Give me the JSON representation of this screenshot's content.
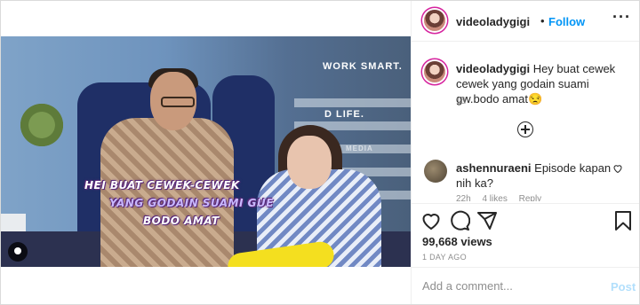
{
  "post": {
    "username": "videoladygigi",
    "separator": "•",
    "follow_label": "Follow",
    "more_label": "···",
    "caption_text": " Hey buat cewek cewek yang godain suami gw.bodo amat😒",
    "caption_time": "1d",
    "video_overlay": {
      "sign_top": "WORK SMART.",
      "sign_mid": "D LIFE.",
      "sign_small": "MEDIA",
      "subtitle_line1": "HEI BUAT CEWEK-CEWEK",
      "subtitle_line2": "YANG GODAIN SUAMI GUE",
      "subtitle_line3": "BODO AMAT"
    }
  },
  "comments": [
    {
      "username": "ashennuraeni",
      "text": " Episode kapan nih ka?",
      "time": "22h",
      "likes": "4 likes",
      "reply": "Reply"
    }
  ],
  "actions": {
    "icons": [
      "heart-icon",
      "comment-icon",
      "share-icon",
      "bookmark-icon"
    ],
    "views": "99,668 views",
    "posted": "1 DAY AGO"
  },
  "composer": {
    "placeholder": "Add a comment...",
    "post_label": "Post"
  },
  "colors": {
    "accent": "#0095f6",
    "post_disabled": "#b2dffc",
    "muted": "#8e8e8e"
  }
}
